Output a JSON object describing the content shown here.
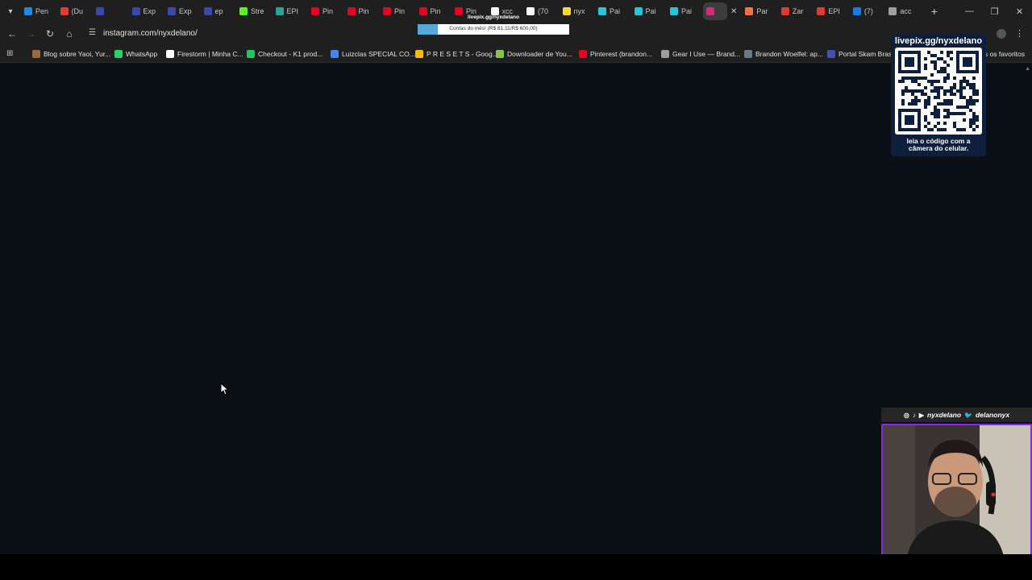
{
  "tabs": [
    {
      "label": "Pen",
      "color": "#1e88e5"
    },
    {
      "label": "(Du",
      "color": "#e53935"
    },
    {
      "label": "",
      "color": "#3949ab"
    },
    {
      "label": "Exp",
      "color": "#3949ab"
    },
    {
      "label": "Exp",
      "color": "#3949ab"
    },
    {
      "label": "ep",
      "color": "#3949ab"
    },
    {
      "label": "Stre",
      "color": "#53fc18"
    },
    {
      "label": "EPI",
      "color": "#26a69a"
    },
    {
      "label": "Pin",
      "color": "#e60023"
    },
    {
      "label": "Pin",
      "color": "#e60023"
    },
    {
      "label": "Pin",
      "color": "#e60023"
    },
    {
      "label": "Pin",
      "color": "#e60023"
    },
    {
      "label": "Pin",
      "color": "#e60023"
    },
    {
      "label": "xcc",
      "color": "#ffffff"
    },
    {
      "label": "(70",
      "color": "#ffffff"
    },
    {
      "label": "nyx",
      "color": "#fdd835"
    },
    {
      "label": "Pai",
      "color": "#26c6da"
    },
    {
      "label": "Pai",
      "color": "#26c6da"
    },
    {
      "label": "Pai",
      "color": "#26c6da"
    },
    {
      "label": "",
      "color": "#d62976",
      "active": true
    },
    {
      "label": "Par",
      "color": "#ff7043"
    },
    {
      "label": "Zar",
      "color": "#e53935"
    },
    {
      "label": "EPI",
      "color": "#e53935"
    },
    {
      "label": "(7)",
      "color": "#1877f2"
    },
    {
      "label": "acc",
      "color": "#9e9e9e"
    }
  ],
  "address": {
    "url": "instagram.com/nyxdelano/"
  },
  "bookmarks": [
    {
      "label": "Blog sobre Yaoi, Yur...",
      "color": "#9c6b3c"
    },
    {
      "label": "WhatsApp",
      "color": "#25d366"
    },
    {
      "label": "Firestorm | Minha C...",
      "color": "#ffffff"
    },
    {
      "label": "Checkout - K1 prod...",
      "color": "#22c55e"
    },
    {
      "label": "Luizclas SPECIAL CO...",
      "color": "#4285f4"
    },
    {
      "label": "P R E S E T S - Goog...",
      "color": "#fbbc04"
    },
    {
      "label": "Downloader de You...",
      "color": "#8bc34a"
    },
    {
      "label": "Pinterest (brandon...",
      "color": "#e60023"
    },
    {
      "label": "Gear I Use — Brand...",
      "color": "#9e9e9e"
    },
    {
      "label": "Brandon Woelfel: ap...",
      "color": "#607d8b"
    },
    {
      "label": "Portal Skam Brasil",
      "color": "#3f51b5"
    }
  ],
  "bookmarks_more": "s os favoritos",
  "goal": {
    "title": "livepix.gg/nyxdelano",
    "text": "Contas do mês! (R$ 81,11/R$ 600,00)",
    "progress": 0.135
  },
  "qr": {
    "title": "livepix.gg/nyxdelano",
    "caption_line1": "leia o código com a",
    "caption_line2": "câmera do celular."
  },
  "social": {
    "handle1": "nyxdelano",
    "handle2": "delanonyx"
  }
}
